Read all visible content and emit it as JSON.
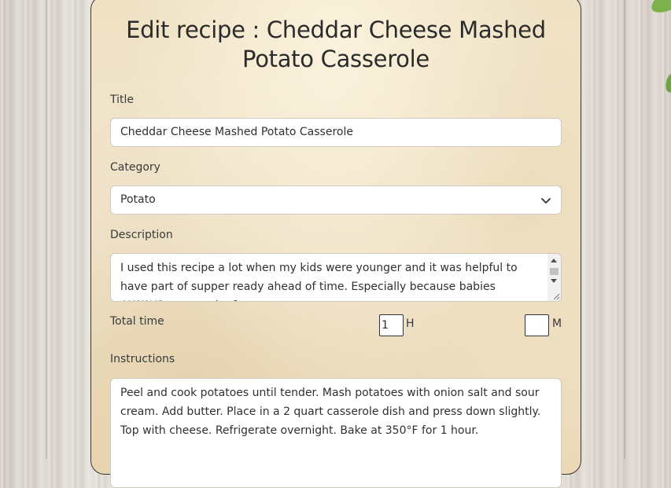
{
  "page": {
    "title": "Edit recipe : Cheddar Cheese Mashed Potato Casserole"
  },
  "form": {
    "title_label": "Title",
    "title_value": "Cheddar Cheese Mashed Potato Casserole",
    "category_label": "Category",
    "category_value": "Potato",
    "description_label": "Description",
    "description_value": "I used this recipe a lot when my kids were younger and it was helpful to have part of supper ready ahead of time. Especially because babies ALWAYS seem to be fussy",
    "total_time_label": "Total time",
    "hours_value": "1",
    "hours_unit": "H",
    "minutes_value": "",
    "minutes_unit": "M",
    "instructions_label": "Instructions",
    "instructions_value": "Peel and cook potatoes until tender. Mash potatoes with onion salt and sour cream. Add butter. Place in a 2 quart casserole dish and press down slightly. Top with cheese. Refrigerate overnight. Bake at 350°F for 1 hour."
  },
  "icons": {
    "select_arrow": "chevron-down-icon",
    "scroll_up": "triangle-up-icon",
    "scroll_down": "triangle-down-icon",
    "resize": "resize-grip-icon"
  },
  "colors": {
    "card_background": "#f1e4c8",
    "card_border": "#3b3833",
    "background_wood": "#dcd7d0",
    "leaf": "#7db24a"
  }
}
